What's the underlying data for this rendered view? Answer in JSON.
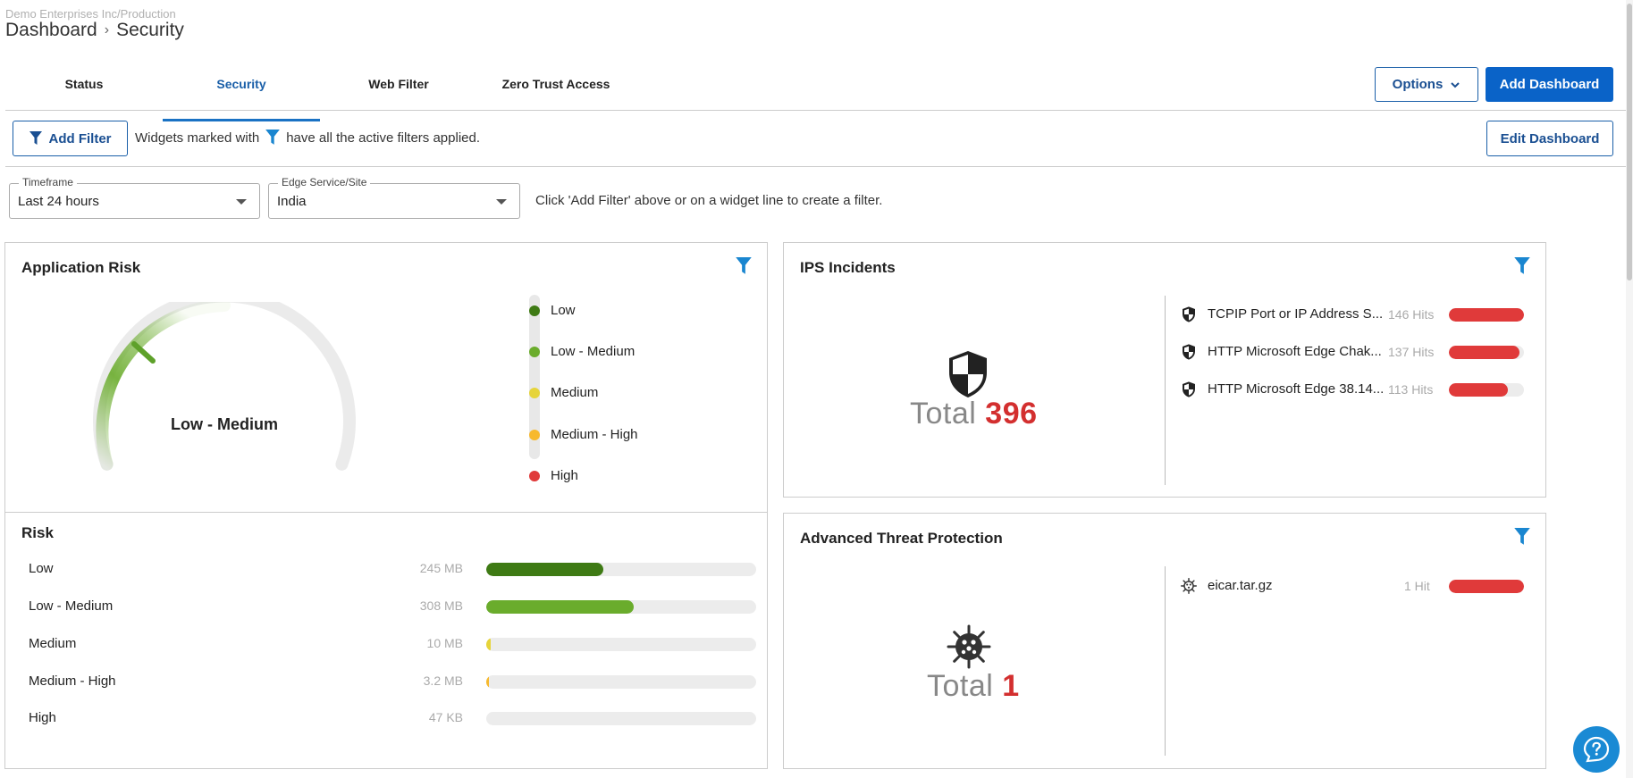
{
  "header": {
    "org_path": "Demo Enterprises Inc/Production",
    "breadcrumb_root": "Dashboard",
    "breadcrumb_separator": "›",
    "breadcrumb_current": "Security"
  },
  "tabs": [
    {
      "label": "Status",
      "active": false
    },
    {
      "label": "Security",
      "active": true
    },
    {
      "label": "Web Filter",
      "active": false
    },
    {
      "label": "Zero Trust Access",
      "active": false
    }
  ],
  "toolbar": {
    "options_label": "Options",
    "add_dashboard_label": "Add Dashboard",
    "add_filter_label": "Add Filter",
    "filter_note_before": "Widgets marked with",
    "filter_note_after": "have all the active filters applied.",
    "edit_dashboard_label": "Edit Dashboard"
  },
  "filters": {
    "timeframe": {
      "label": "Timeframe",
      "value": "Last 24 hours"
    },
    "site": {
      "label": "Edge Service/Site",
      "value": "India"
    },
    "hint": "Click 'Add Filter' above or on a widget line to create a filter."
  },
  "app_risk": {
    "title": "Application Risk",
    "gauge_value": "Low - Medium",
    "legend": [
      {
        "label": "Low",
        "color": "#3e7a14"
      },
      {
        "label": "Low - Medium",
        "color": "#6aac2c"
      },
      {
        "label": "Medium",
        "color": "#e6d43a"
      },
      {
        "label": "Medium - High",
        "color": "#f7b92e"
      },
      {
        "label": "High",
        "color": "#e03a3a"
      }
    ]
  },
  "risk": {
    "title": "Risk",
    "rows": [
      {
        "name": "Low",
        "size": "245 MB",
        "fraction": 0.435,
        "color": "#3e7a14"
      },
      {
        "name": "Low - Medium",
        "size": "308 MB",
        "fraction": 0.545,
        "color": "#6aac2c"
      },
      {
        "name": "Medium",
        "size": "10 MB",
        "fraction": 0.018,
        "color": "#e6d43a"
      },
      {
        "name": "Medium - High",
        "size": "3.2 MB",
        "fraction": 0.006,
        "color": "#f7b92e"
      },
      {
        "name": "High",
        "size": "47 KB",
        "fraction": 0.0,
        "color": "#e03a3a"
      }
    ]
  },
  "ips": {
    "title": "IPS Incidents",
    "total_label": "Total",
    "total_value": "396",
    "items": [
      {
        "name": "TCPIP Port or IP Address S...",
        "hits": "146 Hits",
        "fraction": 1.0
      },
      {
        "name": "HTTP Microsoft Edge Chak...",
        "hits": "137 Hits",
        "fraction": 0.94
      },
      {
        "name": "HTTP Microsoft Edge 38.14...",
        "hits": "113 Hits",
        "fraction": 0.78
      }
    ]
  },
  "atp": {
    "title": "Advanced Threat Protection",
    "total_label": "Total",
    "total_value": "1",
    "items": [
      {
        "name": "eicar.tar.gz",
        "hits": "1 Hit",
        "fraction": 1.0
      }
    ]
  },
  "icons": {
    "filter": "funnel-icon",
    "chevron": "chevron-down-icon",
    "ips": "shield-icon",
    "atp": "virus-icon",
    "help": "help-icon"
  }
}
